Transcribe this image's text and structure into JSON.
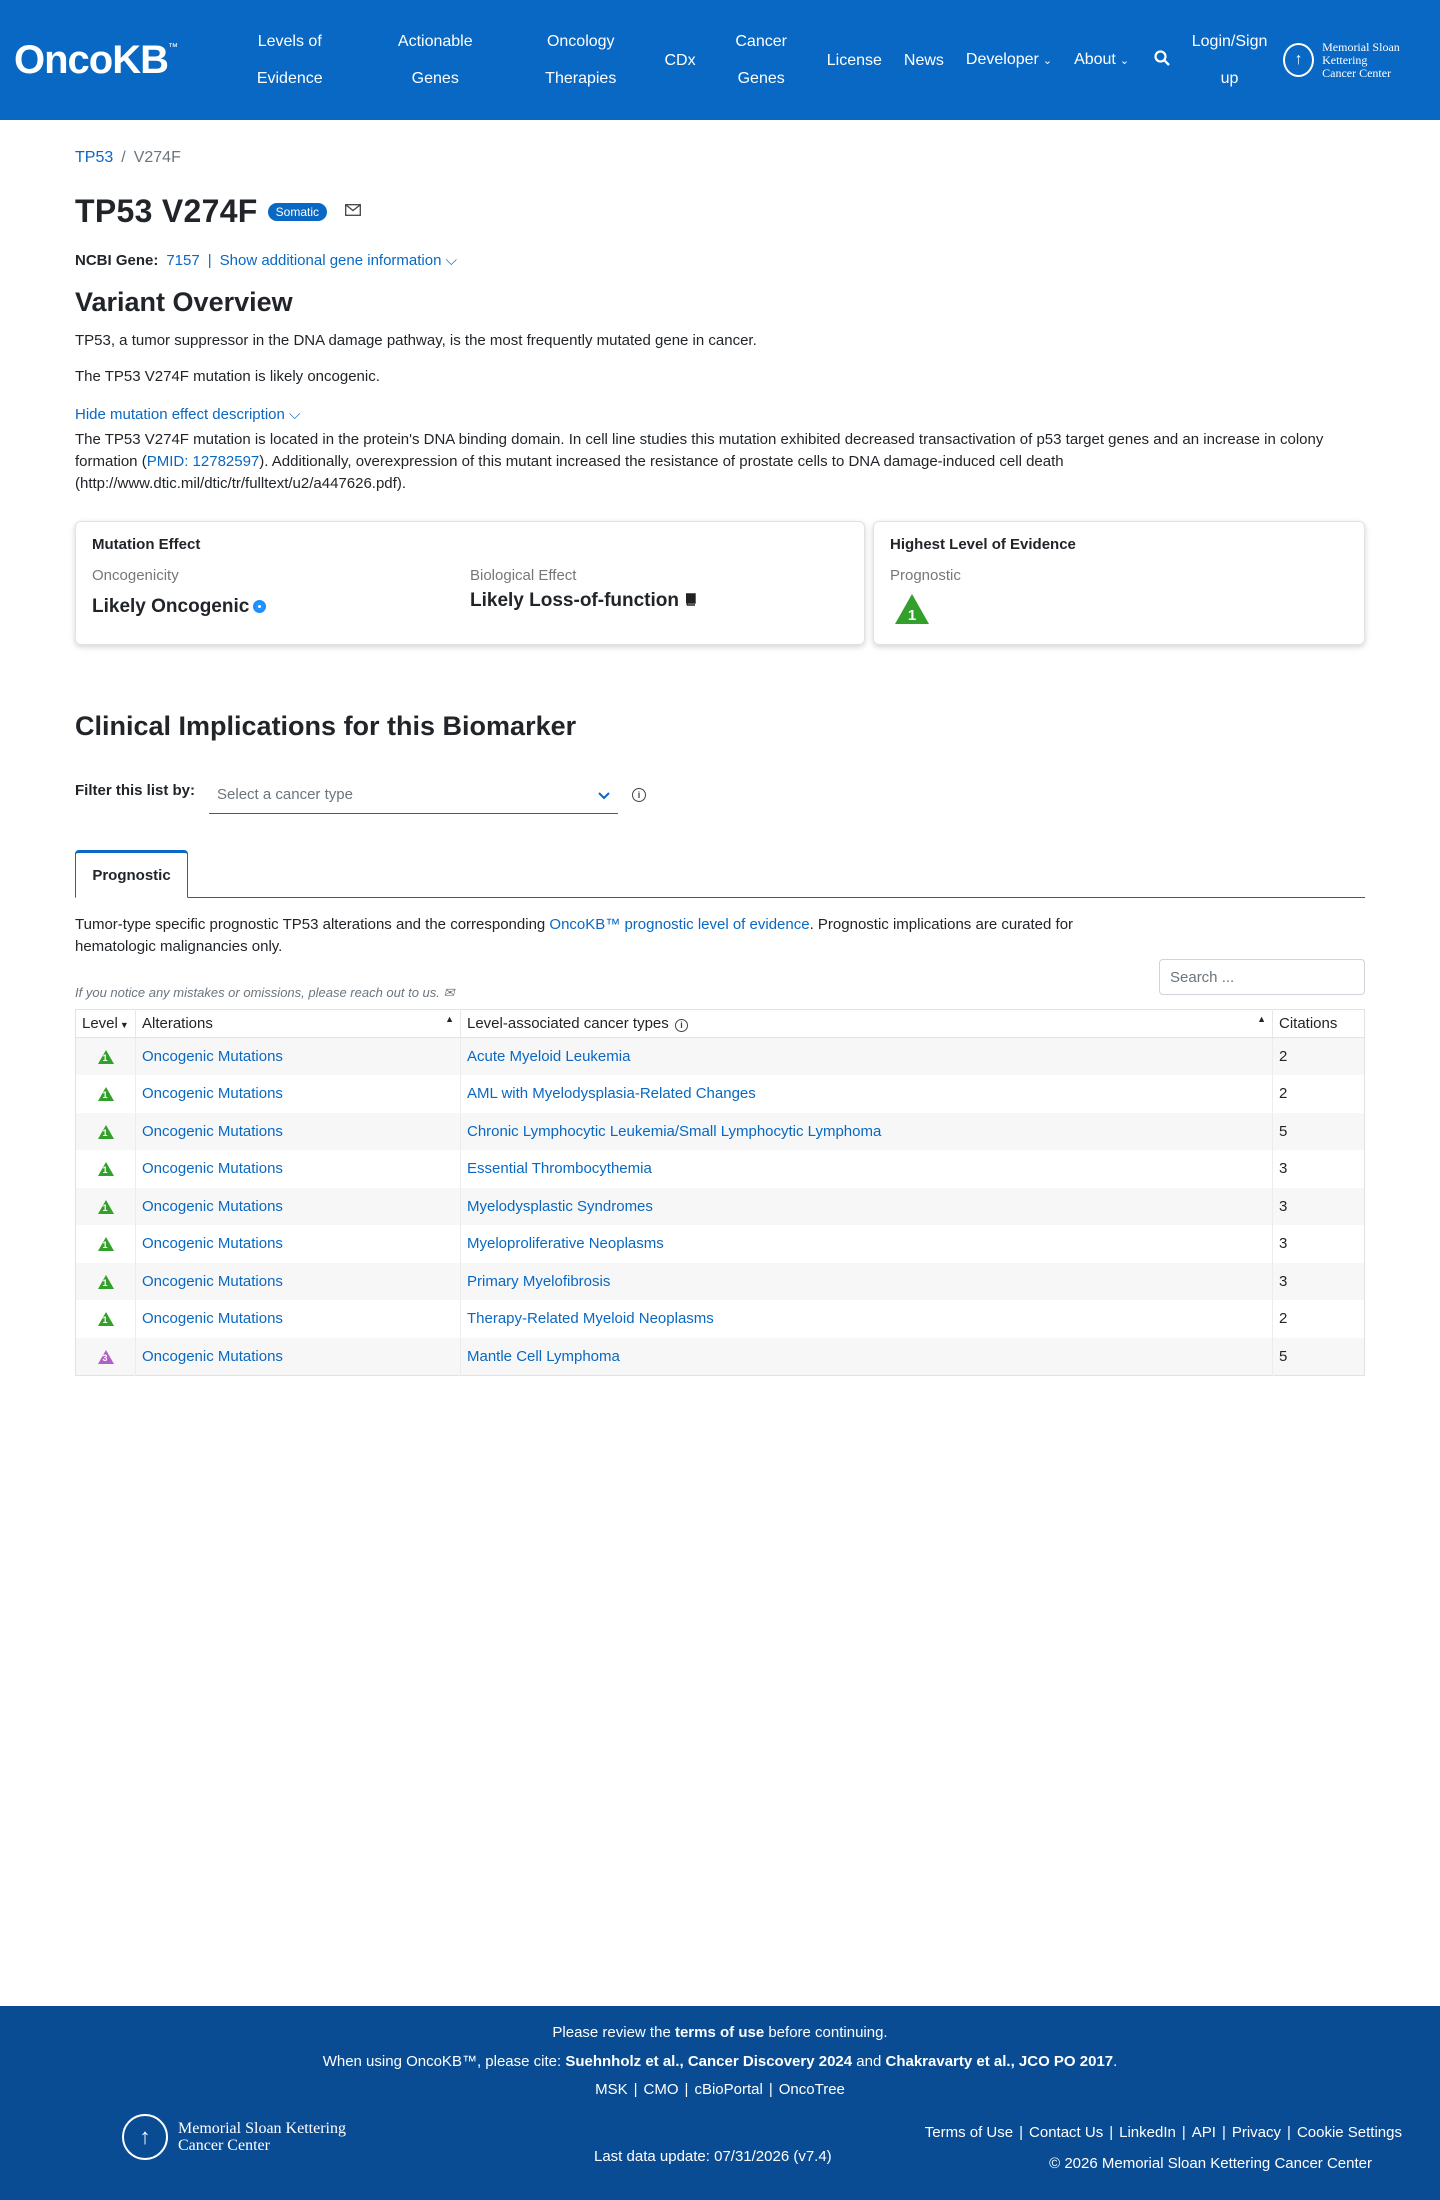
{
  "nav": {
    "logo": "OncoKB",
    "logo_tm": "™",
    "items": [
      {
        "line1": "Levels of",
        "line2": "Evidence"
      },
      {
        "line1": "Actionable",
        "line2": "Genes"
      },
      {
        "line1": "Oncology",
        "line2": "Therapies"
      },
      {
        "line1": "CDx"
      },
      {
        "line1": "Cancer",
        "line2": "Genes"
      },
      {
        "line1": "License"
      },
      {
        "line1": "News"
      },
      {
        "line1": "Developer"
      },
      {
        "line1": "About"
      }
    ],
    "login_line1": "Login/Sign",
    "login_line2": "up",
    "msk_line1": "Memorial Sloan Kettering",
    "msk_line2": "Cancer Center"
  },
  "breadcrumb": {
    "gene": "TP53",
    "sep": "/",
    "current": "V274F"
  },
  "page": {
    "title": "TP53 V274F",
    "badge": "Somatic",
    "ncbi_label": "NCBI Gene:",
    "ncbi_id": "7157",
    "ncbi_sep": "|",
    "show_info": "Show additional gene information"
  },
  "overview": {
    "title": "Variant Overview",
    "p1": "TP53, a tumor suppressor in the DNA damage pathway, is the most frequently mutated gene in cancer.",
    "p2": "The TP53 V274F mutation is likely oncogenic.",
    "hide_link": "Hide mutation effect description",
    "desc_a": "The TP53 V274F mutation is located in the protein's DNA binding domain. In cell line studies this mutation exhibited decreased transactivation of p53 target genes and an increase in colony formation (",
    "desc_pmid": "PMID: 12782597",
    "desc_b": "). Additionally, overexpression of this mutant increased the resistance of prostate cells to DNA damage-induced cell death (http://www.dtic.mil/dtic/tr/fulltext/u2/a447626.pdf)."
  },
  "mutation_effect": {
    "title": "Mutation Effect",
    "oncogenicity_label": "Oncogenicity",
    "oncogenicity_value": "Likely Oncogenic",
    "bio_label": "Biological Effect",
    "bio_value": "Likely Loss-of-function"
  },
  "highest_level": {
    "title": "Highest Level of Evidence",
    "label": "Prognostic",
    "level": "1"
  },
  "clinical": {
    "title": "Clinical Implications for this Biomarker",
    "filter_label": "Filter this list by:",
    "select_placeholder": "Select a cancer type",
    "tab": "Prognostic",
    "desc_a": "Tumor-type specific prognostic TP53 alterations and the corresponding ",
    "desc_link": "OncoKB™ prognostic level of evidence",
    "desc_b": ". Prognostic implications are curated for hematologic malignancies only.",
    "notice": "If you notice any mistakes or omissions, please reach out to us.",
    "search_placeholder": "Search ..."
  },
  "table": {
    "headers": {
      "level": "Level",
      "alterations": "Alterations",
      "cancer_types": "Level-associated cancer types",
      "citations": "Citations"
    },
    "rows": [
      {
        "level": "1",
        "alteration": "Oncogenic Mutations",
        "cancer_type": "Acute Myeloid Leukemia",
        "citations": "2"
      },
      {
        "level": "1",
        "alteration": "Oncogenic Mutations",
        "cancer_type": "AML with Myelodysplasia-Related Changes",
        "citations": "2"
      },
      {
        "level": "1",
        "alteration": "Oncogenic Mutations",
        "cancer_type": "Chronic Lymphocytic Leukemia/Small Lymphocytic Lymphoma",
        "citations": "5"
      },
      {
        "level": "1",
        "alteration": "Oncogenic Mutations",
        "cancer_type": "Essential Thrombocythemia",
        "citations": "3"
      },
      {
        "level": "1",
        "alteration": "Oncogenic Mutations",
        "cancer_type": "Myelodysplastic Syndromes",
        "citations": "3"
      },
      {
        "level": "1",
        "alteration": "Oncogenic Mutations",
        "cancer_type": "Myeloproliferative Neoplasms",
        "citations": "3"
      },
      {
        "level": "1",
        "alteration": "Oncogenic Mutations",
        "cancer_type": "Primary Myelofibrosis",
        "citations": "3"
      },
      {
        "level": "1",
        "alteration": "Oncogenic Mutations",
        "cancer_type": "Therapy-Related Myeloid Neoplasms",
        "citations": "2"
      },
      {
        "level": "3",
        "alteration": "Oncogenic Mutations",
        "cancer_type": "Mantle Cell Lymphoma",
        "citations": "5"
      }
    ]
  },
  "footer": {
    "l1_a": "Please review the ",
    "l1_b": "terms of use",
    "l1_c": " before continuing.",
    "l2_a": "When using OncoKB™, please cite: ",
    "l2_b": "Suehnholz et al., Cancer Discovery 2024",
    "l2_c": " and ",
    "l2_d": "Chakravarty et al., JCO PO 2017",
    "l2_e": ".",
    "links1": [
      "MSK",
      "CMO",
      "cBioPortal",
      "OncoTree"
    ],
    "links2": [
      "Terms of Use",
      "Contact Us",
      "LinkedIn",
      "API",
      "Privacy",
      "Cookie Settings"
    ],
    "msk_line1": "Memorial Sloan Kettering",
    "msk_line2": "Cancer Center",
    "update": "Last data update: 07/31/2026 (v7.4)",
    "copyright": "© 2026 Memorial Sloan Kettering Cancer Center"
  },
  "colors": {
    "brand": "#0968c3",
    "footer": "#0a4c94",
    "level1": "#33a02c",
    "level3": "#b15fc6"
  }
}
